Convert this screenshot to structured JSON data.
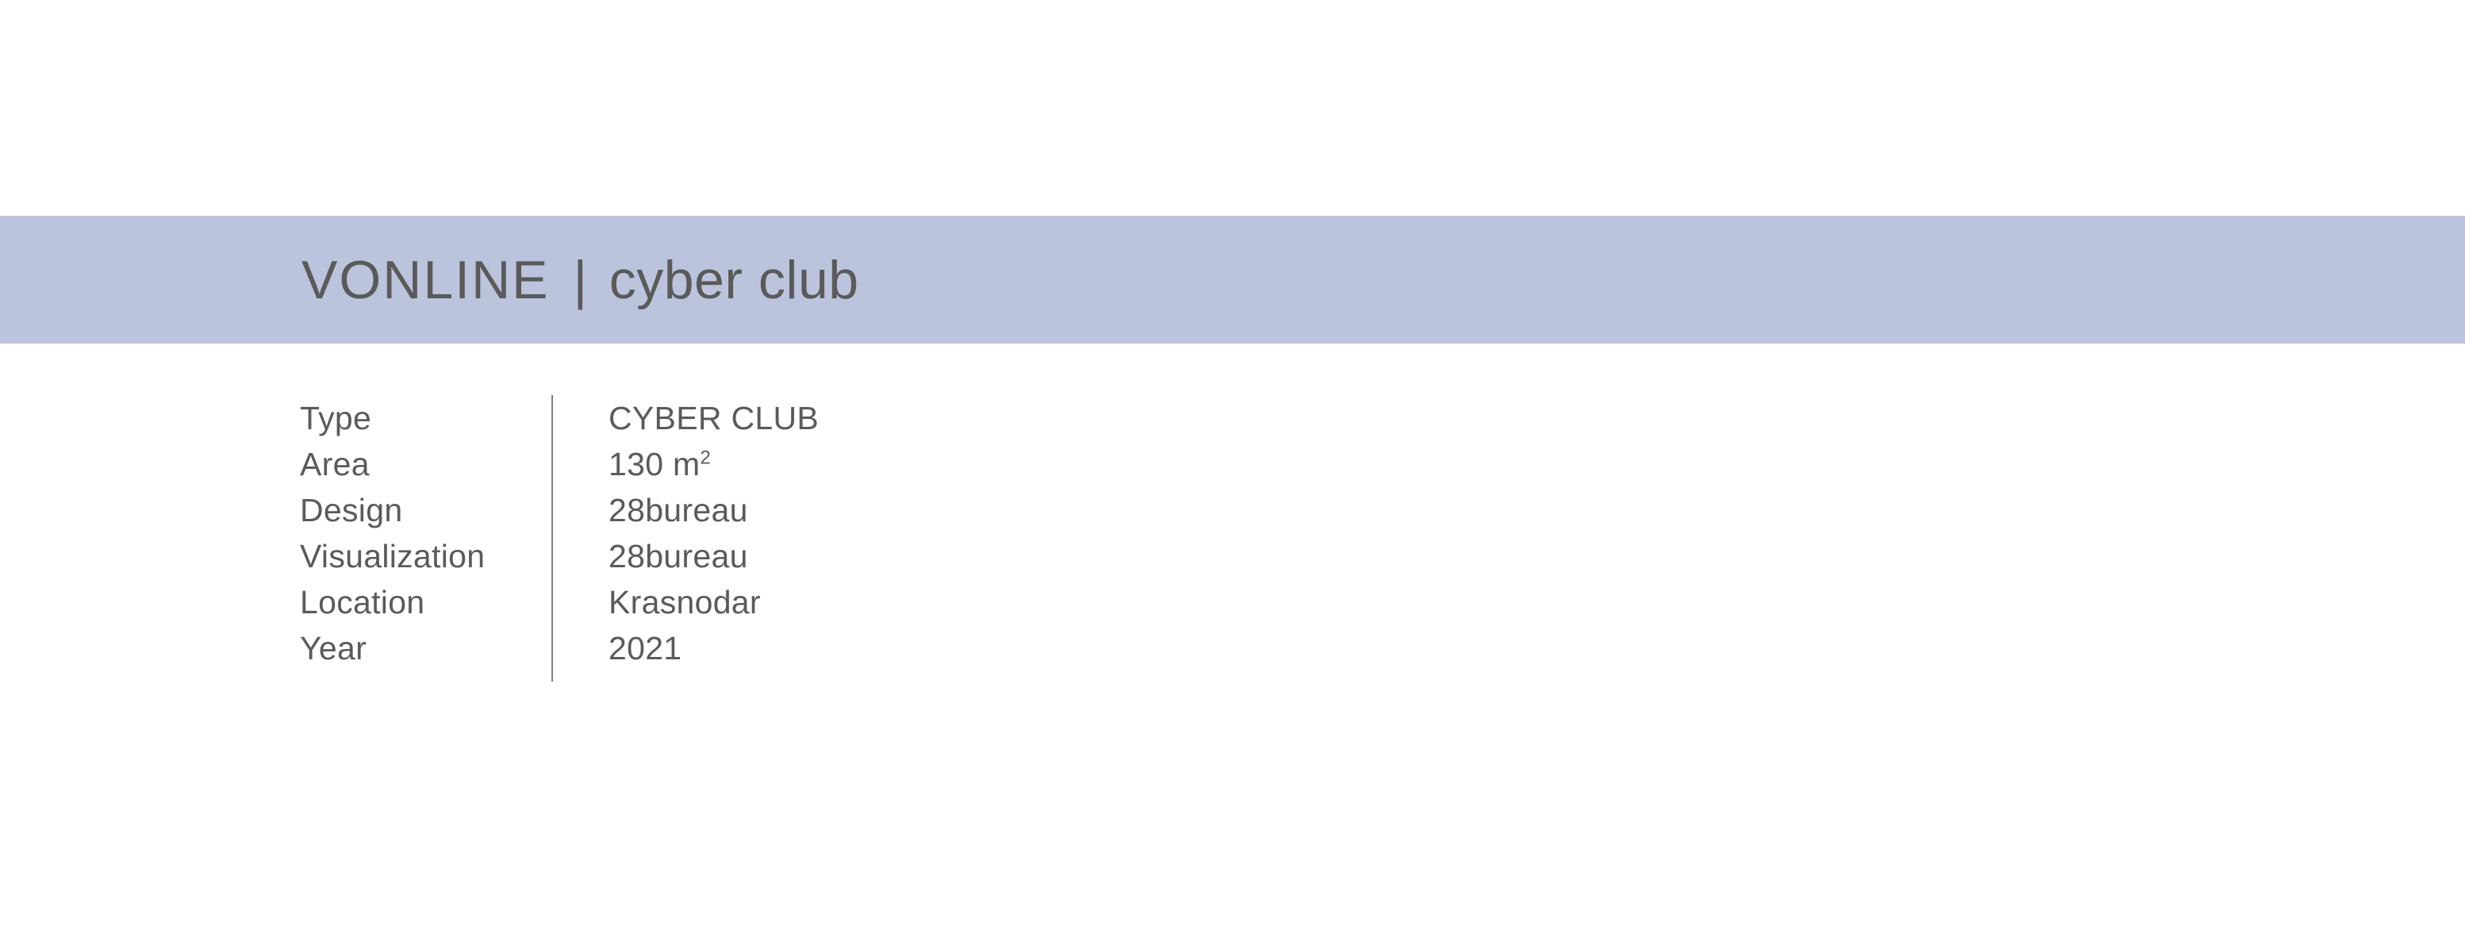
{
  "page": {
    "background_color": "#ffffff",
    "text_color": "#5a5a5a"
  },
  "header": {
    "band_color": "#bcc3dd",
    "brand": "VONLINE",
    "separator": "|",
    "subject": "cyber club",
    "full_title": "VONLINE  |  cyber club"
  },
  "spec_table": {
    "divider_color": "#7d7d7d",
    "rows": [
      {
        "label": "Type",
        "value": "CYBER CLUB",
        "value_sup": ""
      },
      {
        "label": "Area",
        "value": "130 m",
        "value_sup": "2"
      },
      {
        "label": "Design",
        "value": "28bureau",
        "value_sup": ""
      },
      {
        "label": "Visualization",
        "value": "28bureau",
        "value_sup": ""
      },
      {
        "label": "Location",
        "value": "Krasnodar",
        "value_sup": ""
      },
      {
        "label": "Year",
        "value": "2021",
        "value_sup": ""
      }
    ]
  }
}
